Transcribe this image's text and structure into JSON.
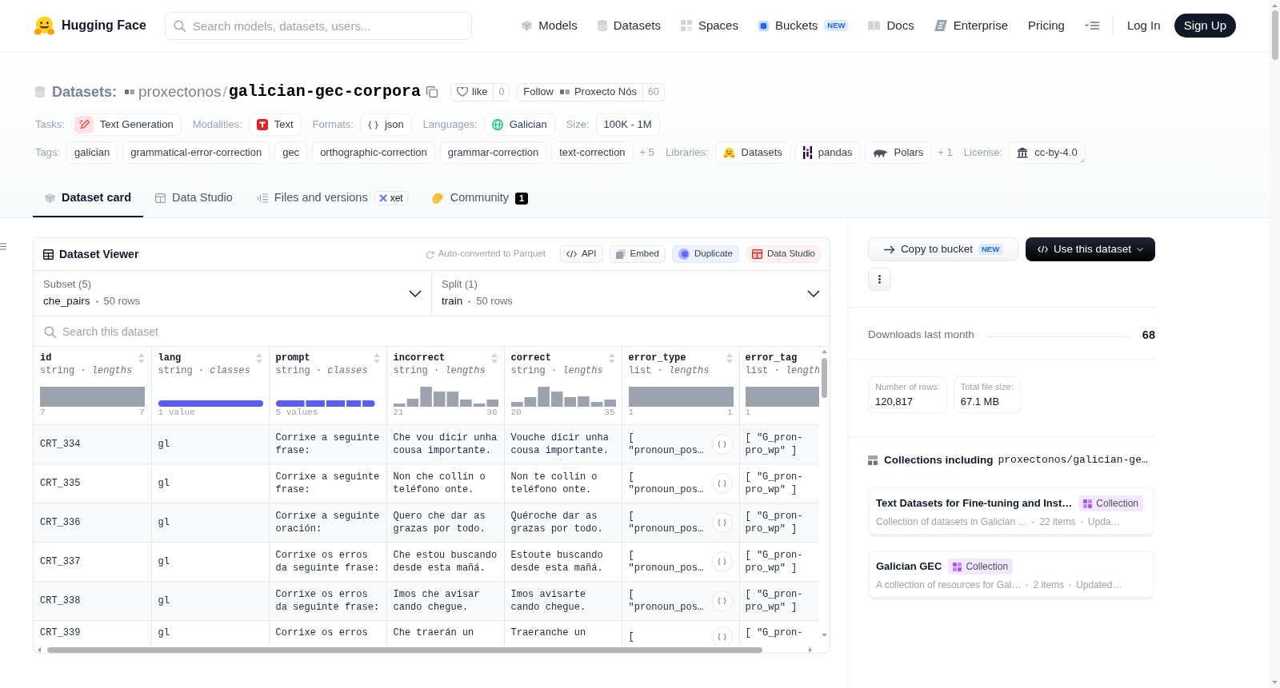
{
  "navbar": {
    "brand": "Hugging Face",
    "search": {
      "placeholder": "Search models, datasets, users..."
    },
    "links": [
      {
        "label": "Models"
      },
      {
        "label": "Datasets"
      },
      {
        "label": "Spaces"
      },
      {
        "label": "Buckets",
        "badge": "NEW"
      },
      {
        "label": "Docs"
      },
      {
        "label": "Enterprise"
      },
      {
        "label": "Pricing"
      }
    ],
    "login": "Log In",
    "signup": "Sign Up"
  },
  "repo": {
    "type_label": "Datasets:",
    "owner": "proxectonos",
    "separator": "/",
    "name": "galician-gec-corpora",
    "like": {
      "label": "like",
      "count": "0"
    },
    "follow": {
      "label": "Follow",
      "org": "Proxecto Nós",
      "count": "60"
    }
  },
  "meta_rows": [
    [
      {
        "label": "Tasks:",
        "chips": [
          "Text Generation"
        ]
      },
      {
        "label": "Modalities:",
        "chips": [
          "Text"
        ]
      },
      {
        "label": "Formats:",
        "chips": [
          "json"
        ]
      },
      {
        "label": "Languages:",
        "chips": [
          "Galician"
        ]
      },
      {
        "label": "Size:",
        "chips": [
          "100K - 1M"
        ]
      }
    ],
    [
      {
        "label": "Tags:",
        "chips": [
          "galician",
          "grammatical-error-correction",
          "gec",
          "orthographic-correction",
          "grammar-correction",
          "text-correction"
        ],
        "more": "+ 5"
      },
      {
        "label": "Libraries:",
        "chips": [
          "Datasets",
          "pandas",
          "Polars"
        ],
        "more": "+ 1"
      },
      {
        "label": "License:",
        "chips": [
          "cc-by-4.0"
        ]
      }
    ]
  ],
  "tabs": [
    {
      "label": "Dataset card",
      "selected": true
    },
    {
      "label": "Data Studio",
      "selected": false
    },
    {
      "label": "Files and versions",
      "badge": "xet",
      "selected": false
    },
    {
      "label": "Community",
      "count": "1",
      "selected": false
    }
  ],
  "viewer": {
    "title": "Dataset Viewer",
    "conversion": {
      "link": "Auto-converted",
      "text": "to Parquet"
    },
    "buttons": [
      {
        "label": "API",
        "kind": "plain"
      },
      {
        "label": "Embed",
        "kind": "plain"
      },
      {
        "label": "Duplicate",
        "kind": "accent"
      },
      {
        "label": "Data Studio",
        "kind": "danger"
      }
    ],
    "selectors": [
      {
        "label": "Subset (5)",
        "value": "che_pairs",
        "count": "50 rows"
      },
      {
        "label": "Split (1)",
        "value": "train",
        "count": "50 rows"
      }
    ],
    "search": {
      "placeholder": "Search this dataset"
    },
    "columns": [
      {
        "name": "id",
        "type": "string · *lengths*",
        "kind": "uniform",
        "min": "7",
        "max": "7"
      },
      {
        "name": "lang",
        "type": "string · *classes*",
        "kind": "single",
        "summary": "1 value"
      },
      {
        "name": "prompt",
        "type": "string · *classes*",
        "kind": "classes",
        "summary": "5 values"
      },
      {
        "name": "incorrect",
        "type": "string · *lengths*",
        "kind": "histogram",
        "min": "21",
        "max": "36"
      },
      {
        "name": "correct",
        "type": "string · *lengths*",
        "kind": "histogram",
        "min": "20",
        "max": "35"
      },
      {
        "name": "error_type",
        "type": "list · *lengths*",
        "kind": "uniform",
        "min": "1",
        "max": "1"
      },
      {
        "name": "error_tag",
        "type": "list · *length*",
        "kind": "uniform",
        "min": "1"
      }
    ],
    "rows": [
      {
        "cells": [
          "CRT_334",
          "gl",
          "Corrixe a seguinte frase:",
          "Che vou dicir unha cousa importante.",
          "Vouche dicir unha cousa importante.",
          "[ \"pronoun_pos…",
          "[ \"G_pron-pro_wp\" ]"
        ]
      },
      {
        "cells": [
          "CRT_335",
          "gl",
          "Corrixe a seguinte frase:",
          "Non che collín o teléfono onte.",
          "Non te collín o teléfono onte.",
          "[ \"pronoun_pos…",
          "[ \"G_pron-pro_wp\" ]"
        ]
      },
      {
        "cells": [
          "CRT_336",
          "gl",
          "Corrixe a seguinte oración:",
          "Quero che dar as grazas por todo.",
          "Quéroche dar as grazas por todo.",
          "[ \"pronoun_pos…",
          "[ \"G_pron-pro_wp\" ]"
        ]
      },
      {
        "cells": [
          "CRT_337",
          "gl",
          "Corrixe os erros da seguinte frase:",
          "Che estou buscando desde esta mañá.",
          "Estoute buscando desde esta mañá.",
          "[ \"pronoun_pos…",
          "[ \"G_pron-pro_wp\" ]"
        ]
      },
      {
        "cells": [
          "CRT_338",
          "gl",
          "Corrixe os erros da seguinte frase:",
          "Imos che avisar cando chegue.",
          "Imos avisarte cando chegue.",
          "[ \"pronoun_pos…",
          "[ \"G_pron-pro_wp\" ]"
        ]
      },
      {
        "cells": [
          "CRT_339",
          "gl",
          "Corrixe os erros",
          "Che traerán un",
          "Traeranche un",
          "[",
          "[ \"G_pron-"
        ]
      }
    ]
  },
  "sidebar": {
    "copy_button": {
      "label": "Copy to bucket",
      "badge": "NEW"
    },
    "use_button": {
      "label": "Use this dataset"
    },
    "downloads": {
      "label": "Downloads last month",
      "value": "68"
    },
    "stats": [
      {
        "label": "Number of rows:",
        "value": "120,817"
      },
      {
        "label": "Total file size:",
        "value": "67.1 MB"
      }
    ],
    "collections": {
      "title": "Collections including",
      "repo": "proxectonos/galician-ge…",
      "items": [
        {
          "title": "Text Datasets for Fine-tuning and Inst…",
          "badge": "Collection",
          "description": "Collection of datasets in Galician …",
          "count": "22 items",
          "updated": "Upda…"
        },
        {
          "title": "Galician GEC",
          "badge": "Collection",
          "description": "A collection of resources for Gal…",
          "count": "2 items",
          "updated": "Updated…"
        }
      ]
    }
  }
}
